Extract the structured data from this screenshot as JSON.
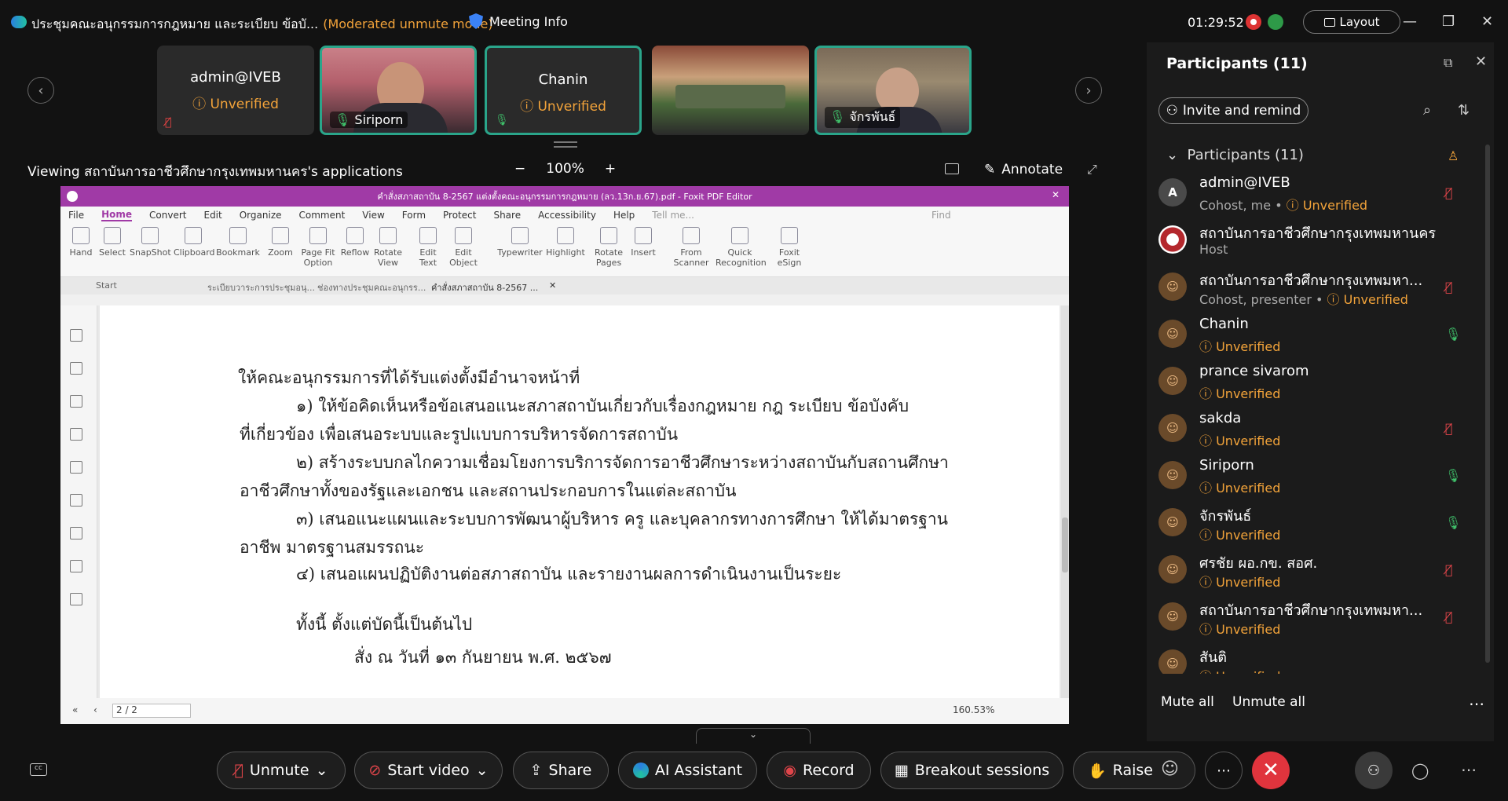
{
  "window": {
    "title": "ประชุมคณะอนุกรรมการกฎหมาย และระเบียบ ข้อบั...",
    "mode": "(Moderated unmute mode)",
    "meeting_info": "Meeting Info",
    "timer": "01:29:52",
    "layout_label": "Layout"
  },
  "filmstrip": {
    "tiles": [
      {
        "name": "admin@IVEB",
        "status": "Unverified"
      },
      {
        "name": "Siriporn"
      },
      {
        "name": "Chanin",
        "status": "Unverified"
      },
      {
        "name": ""
      },
      {
        "name": "จักรพันธ์"
      }
    ]
  },
  "share": {
    "viewing_text": "Viewing สถาบันการอาชีวศึกษากรุงเทพมหานคร's applications",
    "zoom": "100%",
    "annotate": "Annotate"
  },
  "foxit": {
    "title": "คำสั่งสภาสถาบัน 8-2567 แต่งตั้งคณะอนุกรรมการกฎหมาย (ลว.13ก.ย.67).pdf - Foxit PDF Editor",
    "menu": [
      "File",
      "Home",
      "Convert",
      "Edit",
      "Organize",
      "Comment",
      "View",
      "Form",
      "Protect",
      "Share",
      "Accessibility",
      "Help"
    ],
    "tellme": "Tell me...",
    "find": "Find",
    "ribbon": [
      "Hand",
      "Select",
      "SnapShot",
      "Clipboard",
      "Bookmark",
      "Zoom",
      "Page Fit Option",
      "Reflow",
      "Rotate View",
      "Edit Text",
      "Edit Object",
      "Typewriter",
      "Highlight",
      "Rotate Pages",
      "Insert",
      "From Scanner",
      "Quick Recognition",
      "Foxit eSign"
    ],
    "tabs": [
      "Start",
      "ระเบียบวาระการประชุมอนุ...",
      "ช่องทางประชุมคณะอนุกรร...",
      "คำสั่งสภาสถาบัน 8-2567 ..."
    ],
    "page_lines": [
      "ให้คณะอนุกรรมการที่ได้รับแต่งตั้งมีอำนาจหน้าที่",
      "๑) ให้ข้อคิดเห็นหรือข้อเสนอแนะสภาสถาบันเกี่ยวกับเรื่องกฎหมาย กฎ ระเบียบ ข้อบังคับ",
      "ที่เกี่ยวข้อง เพื่อเสนอระบบและรูปแบบการบริหารจัดการสถาบัน",
      "๒) สร้างระบบกลไกความเชื่อมโยงการบริการจัดการอาชีวศึกษาระหว่างสถาบันกับสถานศึกษา",
      "อาชีวศึกษาทั้งของรัฐและเอกชน และสถานประกอบการในแต่ละสถาบัน",
      "๓) เสนอแนะแผนและระบบการพัฒนาผู้บริหาร ครู และบุคลากรทางการศึกษา ให้ได้มาตรฐาน",
      "อาชีพ มาตรฐานสมรรถนะ",
      "๔) เสนอแผนปฏิบัติงานต่อสภาสถาบัน และรายงานผลการดำเนินงานเป็นระยะ",
      "ทั้งนี้ ตั้งแต่บัดนี้เป็นต้นไป",
      "สั่ง ณ วันที่ ๑๓ กันยายน พ.ศ. ๒๕๖๗"
    ],
    "page_num": "2 / 2",
    "zoom_pct": "160.53%"
  },
  "panel": {
    "title": "Participants (11)",
    "invite": "Invite and remind",
    "group_label": "Participants (11)",
    "participants": [
      {
        "name": "admin@IVEB",
        "role": "Cohost, me",
        "status": "Unverified",
        "avatar": "A",
        "mic": "off"
      },
      {
        "name": "สถาบันการอาชีวศึกษากรุงเทพมหานคร",
        "role": "Host",
        "status": "",
        "avatar": "logo",
        "mic": "none"
      },
      {
        "name": "สถาบันการอาชีวศึกษากรุงเทพมหา...",
        "role": "Cohost, presenter",
        "status": "Unverified",
        "avatar": "person",
        "mic": "off"
      },
      {
        "name": "Chanin",
        "role": "",
        "status": "Unverified",
        "avatar": "person",
        "mic": "on"
      },
      {
        "name": "prance sivarom",
        "role": "",
        "status": "Unverified",
        "avatar": "person",
        "mic": "none"
      },
      {
        "name": "sakda",
        "role": "",
        "status": "Unverified",
        "avatar": "person",
        "mic": "off"
      },
      {
        "name": "Siriporn",
        "role": "",
        "status": "Unverified",
        "avatar": "person",
        "mic": "on"
      },
      {
        "name": "จักรพันธ์",
        "role": "",
        "status": "Unverified",
        "avatar": "person",
        "mic": "on"
      },
      {
        "name": "ศรชัย ผอ.กข. สอศ.",
        "role": "",
        "status": "Unverified",
        "avatar": "person",
        "mic": "off"
      },
      {
        "name": "สถาบันการอาชีวศึกษากรุงเทพมหา...",
        "role": "",
        "status": "Unverified",
        "avatar": "person",
        "mic": "off"
      },
      {
        "name": "สันติ",
        "role": "",
        "status": "Unverified",
        "avatar": "person",
        "mic": "none"
      }
    ],
    "mute_all": "Mute all",
    "unmute_all": "Unmute all"
  },
  "toolbar": {
    "unmute": "Unmute",
    "start_video": "Start video",
    "share": "Share",
    "ai_assistant": "AI Assistant",
    "record": "Record",
    "breakout": "Breakout sessions",
    "raise": "Raise"
  },
  "colors": {
    "accent_teal": "#2aa58a",
    "warning": "#f2a33a",
    "leave_red": "#e0343d",
    "foxit_purple": "#a03aa6"
  }
}
